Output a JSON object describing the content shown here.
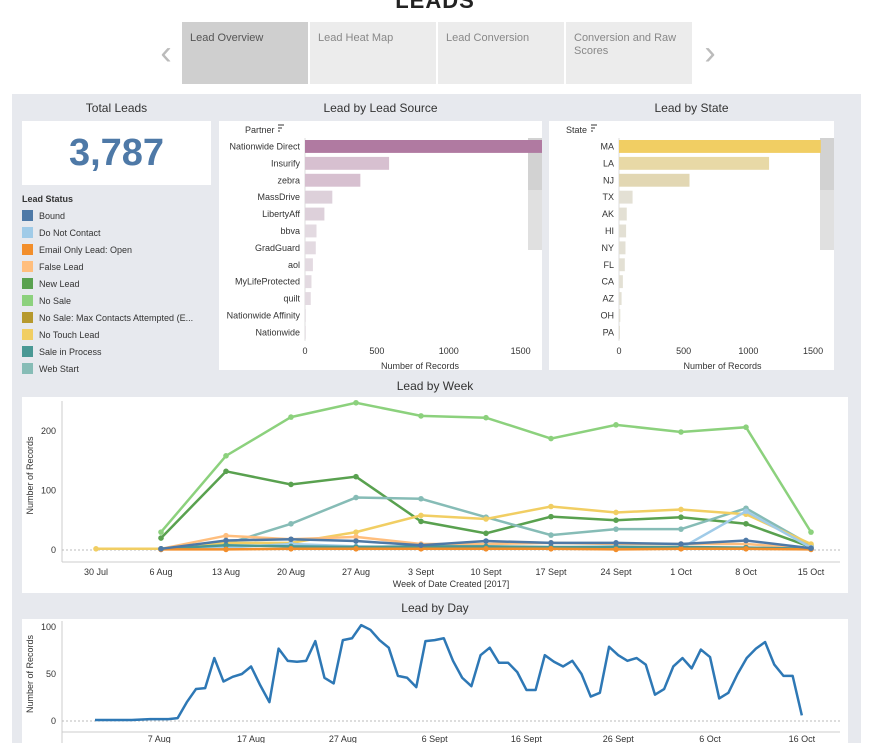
{
  "page": {
    "title": "LEADS"
  },
  "story_nav": {
    "prev_icon": "chevron-left-icon",
    "next_icon": "chevron-right-icon",
    "tabs": [
      {
        "label": "Lead Overview",
        "active": true
      },
      {
        "label": "Lead Heat Map",
        "active": false
      },
      {
        "label": "Lead Conversion",
        "active": false
      },
      {
        "label": "Conversion and Raw Scores",
        "active": false
      }
    ]
  },
  "total_leads": {
    "title": "Total Leads",
    "value": "3,787"
  },
  "lead_status": {
    "title": "Lead Status",
    "items": [
      {
        "label": "Bound",
        "color": "#4e79a7"
      },
      {
        "label": "Do Not Contact",
        "color": "#a0cbe8"
      },
      {
        "label": "Email Only Lead: Open",
        "color": "#f28e2b"
      },
      {
        "label": "False Lead",
        "color": "#ffbe7d"
      },
      {
        "label": "New Lead",
        "color": "#59a14f"
      },
      {
        "label": "No Sale",
        "color": "#8cd17d"
      },
      {
        "label": "No Sale: Max Contacts Attempted (E...",
        "color": "#b6992d"
      },
      {
        "label": "No Touch Lead",
        "color": "#f1ce63"
      },
      {
        "label": "Sale in Process",
        "color": "#499894"
      },
      {
        "label": "Web Start",
        "color": "#86bcb6"
      }
    ]
  },
  "chart_data": [
    {
      "type": "bar",
      "title": "Lead by Lead Source",
      "dimension_label": "Partner",
      "xlabel": "Number of Records",
      "xlim": [
        0,
        1600
      ],
      "xticks": [
        0,
        500,
        1000,
        1500
      ],
      "categories": [
        "Nationwide Direct",
        "Insurify",
        "zebra",
        "MassDrive",
        "LibertyAff",
        "bbva",
        "GradGuard",
        "aol",
        "MyLifeProtected",
        "quilt",
        "Nationwide Affinity",
        "Nationwide"
      ],
      "values": [
        1840,
        585,
        385,
        190,
        135,
        80,
        75,
        55,
        45,
        40,
        5,
        3
      ],
      "colors": [
        "#b07aa1",
        "#d7c0d0",
        "#d7c0d0",
        "#ddd0da",
        "#ddd0da",
        "#e3dae1",
        "#e3dae1",
        "#e3dae1",
        "#e3dae1",
        "#e3dae1",
        "#e9e4e8",
        "#e9e4e8"
      ]
    },
    {
      "type": "bar",
      "title": "Lead by State",
      "dimension_label": "State",
      "xlabel": "Number of Records",
      "xlim": [
        0,
        1600
      ],
      "xticks": [
        0,
        500,
        1000,
        1500
      ],
      "categories": [
        "MA",
        "LA",
        "NJ",
        "TX",
        "AK",
        "HI",
        "NY",
        "FL",
        "CA",
        "AZ",
        "OH",
        "PA"
      ],
      "values": [
        1560,
        1160,
        545,
        105,
        60,
        55,
        50,
        45,
        30,
        20,
        10,
        5
      ],
      "colors": [
        "#f1ce63",
        "#e8d9a6",
        "#e2d7b3",
        "#e3e0d4",
        "#e3e0d4",
        "#e3e0d4",
        "#e3e0d4",
        "#e3e0d4",
        "#e3e0d4",
        "#e3e0d4",
        "#e3e0d4",
        "#e3e0d4"
      ]
    },
    {
      "type": "line",
      "title": "Lead by Week",
      "xlabel": "Week of Date Created [2017]",
      "ylabel": "Number of Records",
      "ylim": [
        0,
        250
      ],
      "yticks": [
        0,
        100,
        200
      ],
      "x": [
        "30 Jul",
        "6 Aug",
        "13 Aug",
        "20 Aug",
        "27 Aug",
        "3 Sept",
        "10 Sept",
        "17 Sept",
        "24 Sept",
        "1 Oct",
        "8 Oct",
        "15 Oct"
      ],
      "series": [
        {
          "name": "No Sale",
          "color": "#8cd17d",
          "values": [
            null,
            30,
            158,
            223,
            247,
            225,
            222,
            187,
            210,
            198,
            206,
            30
          ]
        },
        {
          "name": "New Lead",
          "color": "#59a14f",
          "values": [
            null,
            20,
            132,
            110,
            123,
            48,
            28,
            56,
            50,
            55,
            44,
            5
          ]
        },
        {
          "name": "Web Start",
          "color": "#86bcb6",
          "values": [
            null,
            2,
            10,
            44,
            88,
            86,
            55,
            25,
            35,
            35,
            70,
            8
          ]
        },
        {
          "name": "No Touch Lead",
          "color": "#f1ce63",
          "values": [
            2,
            2,
            12,
            12,
            30,
            58,
            52,
            73,
            63,
            68,
            60,
            10
          ]
        },
        {
          "name": "False Lead",
          "color": "#ffbe7d",
          "values": [
            null,
            2,
            24,
            18,
            22,
            10,
            10,
            12,
            10,
            10,
            10,
            3
          ]
        },
        {
          "name": "Do Not Contact",
          "color": "#a0cbe8",
          "values": [
            null,
            1,
            4,
            10,
            6,
            4,
            6,
            4,
            6,
            3,
            65,
            4
          ]
        },
        {
          "name": "Sale in Process",
          "color": "#499894",
          "values": [
            null,
            2,
            8,
            6,
            5,
            6,
            6,
            5,
            5,
            5,
            4,
            2
          ]
        },
        {
          "name": "Email Only Lead: Open",
          "color": "#f28e2b",
          "values": [
            null,
            1,
            1,
            2,
            2,
            2,
            2,
            2,
            1,
            2,
            2,
            1
          ]
        },
        {
          "name": "Bound",
          "color": "#4e79a7",
          "values": [
            null,
            2,
            16,
            18,
            15,
            8,
            15,
            12,
            12,
            10,
            16,
            3
          ]
        }
      ]
    },
    {
      "type": "line",
      "title": "Lead by Day",
      "ylabel": "Number of Records",
      "ylim": [
        0,
        100
      ],
      "yticks": [
        0,
        50,
        100
      ],
      "tick_labels": [
        "7 Aug",
        "17 Aug",
        "27 Aug",
        "6 Sept",
        "16 Sept",
        "26 Sept",
        "6 Oct",
        "16 Oct"
      ],
      "tick_positions": [
        7,
        17,
        27,
        37,
        47,
        57,
        67,
        77
      ],
      "x_start": 0,
      "x_end": 78,
      "series": [
        {
          "name": "",
          "color": "#2e78b5",
          "points": [
            [
              0,
              1
            ],
            [
              4,
              1
            ],
            [
              6,
              2
            ],
            [
              7,
              2
            ],
            [
              8,
              2
            ],
            [
              9,
              3
            ],
            [
              10,
              20
            ],
            [
              11,
              34
            ],
            [
              12,
              35
            ],
            [
              13,
              67
            ],
            [
              14,
              42
            ],
            [
              15,
              47
            ],
            [
              16,
              50
            ],
            [
              17,
              58
            ],
            [
              18,
              38
            ],
            [
              19,
              20
            ],
            [
              20,
              77
            ],
            [
              21,
              64
            ],
            [
              22,
              63
            ],
            [
              23,
              64
            ],
            [
              24,
              85
            ],
            [
              25,
              46
            ],
            [
              26,
              40
            ],
            [
              27,
              86
            ],
            [
              28,
              88
            ],
            [
              29,
              102
            ],
            [
              30,
              97
            ],
            [
              31,
              86
            ],
            [
              32,
              78
            ],
            [
              33,
              48
            ],
            [
              34,
              46
            ],
            [
              35,
              36
            ],
            [
              36,
              85
            ],
            [
              37,
              86
            ],
            [
              38,
              88
            ],
            [
              39,
              64
            ],
            [
              40,
              46
            ],
            [
              41,
              37
            ],
            [
              42,
              70
            ],
            [
              43,
              78
            ],
            [
              44,
              62
            ],
            [
              45,
              62
            ],
            [
              46,
              52
            ],
            [
              47,
              33
            ],
            [
              48,
              33
            ],
            [
              49,
              70
            ],
            [
              50,
              63
            ],
            [
              51,
              58
            ],
            [
              52,
              64
            ],
            [
              53,
              50
            ],
            [
              54,
              26
            ],
            [
              55,
              30
            ],
            [
              56,
              79
            ],
            [
              57,
              70
            ],
            [
              58,
              64
            ],
            [
              59,
              67
            ],
            [
              60,
              60
            ],
            [
              61,
              28
            ],
            [
              62,
              34
            ],
            [
              63,
              58
            ],
            [
              64,
              67
            ],
            [
              65,
              56
            ],
            [
              66,
              76
            ],
            [
              67,
              68
            ],
            [
              68,
              24
            ],
            [
              69,
              30
            ],
            [
              70,
              50
            ],
            [
              71,
              67
            ],
            [
              72,
              77
            ],
            [
              73,
              84
            ],
            [
              74,
              60
            ],
            [
              75,
              48
            ],
            [
              76,
              48
            ],
            [
              77,
              6
            ]
          ]
        }
      ]
    }
  ]
}
